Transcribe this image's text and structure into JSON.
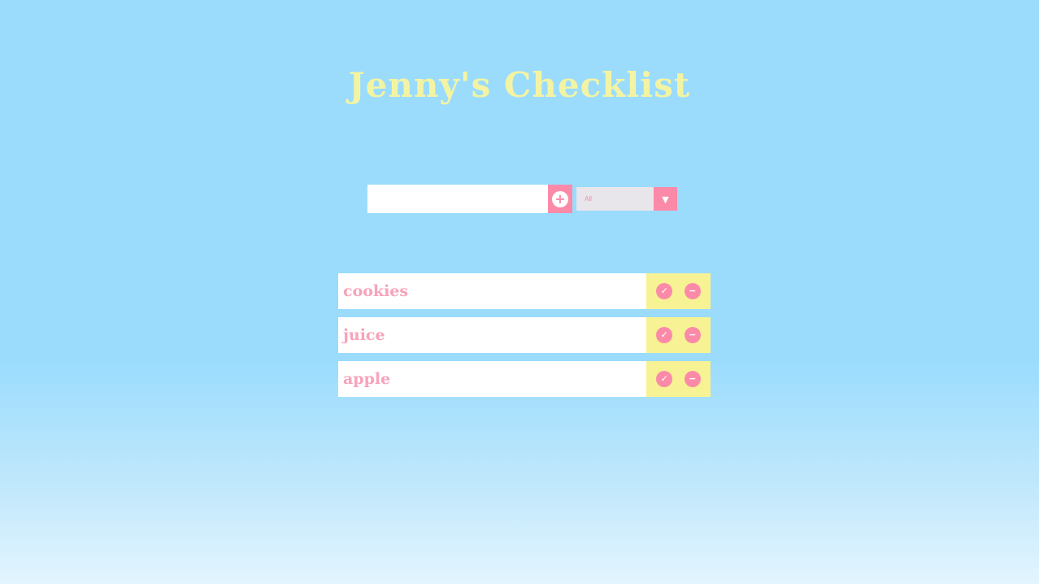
{
  "header": {
    "title": "Jenny's Checklist"
  },
  "add_form": {
    "input_value": "",
    "input_placeholder": "",
    "add_icon": "+"
  },
  "filter": {
    "selected": "All",
    "arrow_icon": "▼"
  },
  "todos": [
    {
      "text": "cookies",
      "check_icon": "✓",
      "remove_icon": "−"
    },
    {
      "text": "juice",
      "check_icon": "✓",
      "remove_icon": "−"
    },
    {
      "text": "apple",
      "check_icon": "✓",
      "remove_icon": "−"
    }
  ],
  "colors": {
    "background": "#9bdcfd",
    "title": "#f3f4a3",
    "accent_pink": "#fb8aa9",
    "todo_text": "#f7a3bb",
    "actions_bg": "#f7f293",
    "filter_bg": "#e8e6ea"
  }
}
